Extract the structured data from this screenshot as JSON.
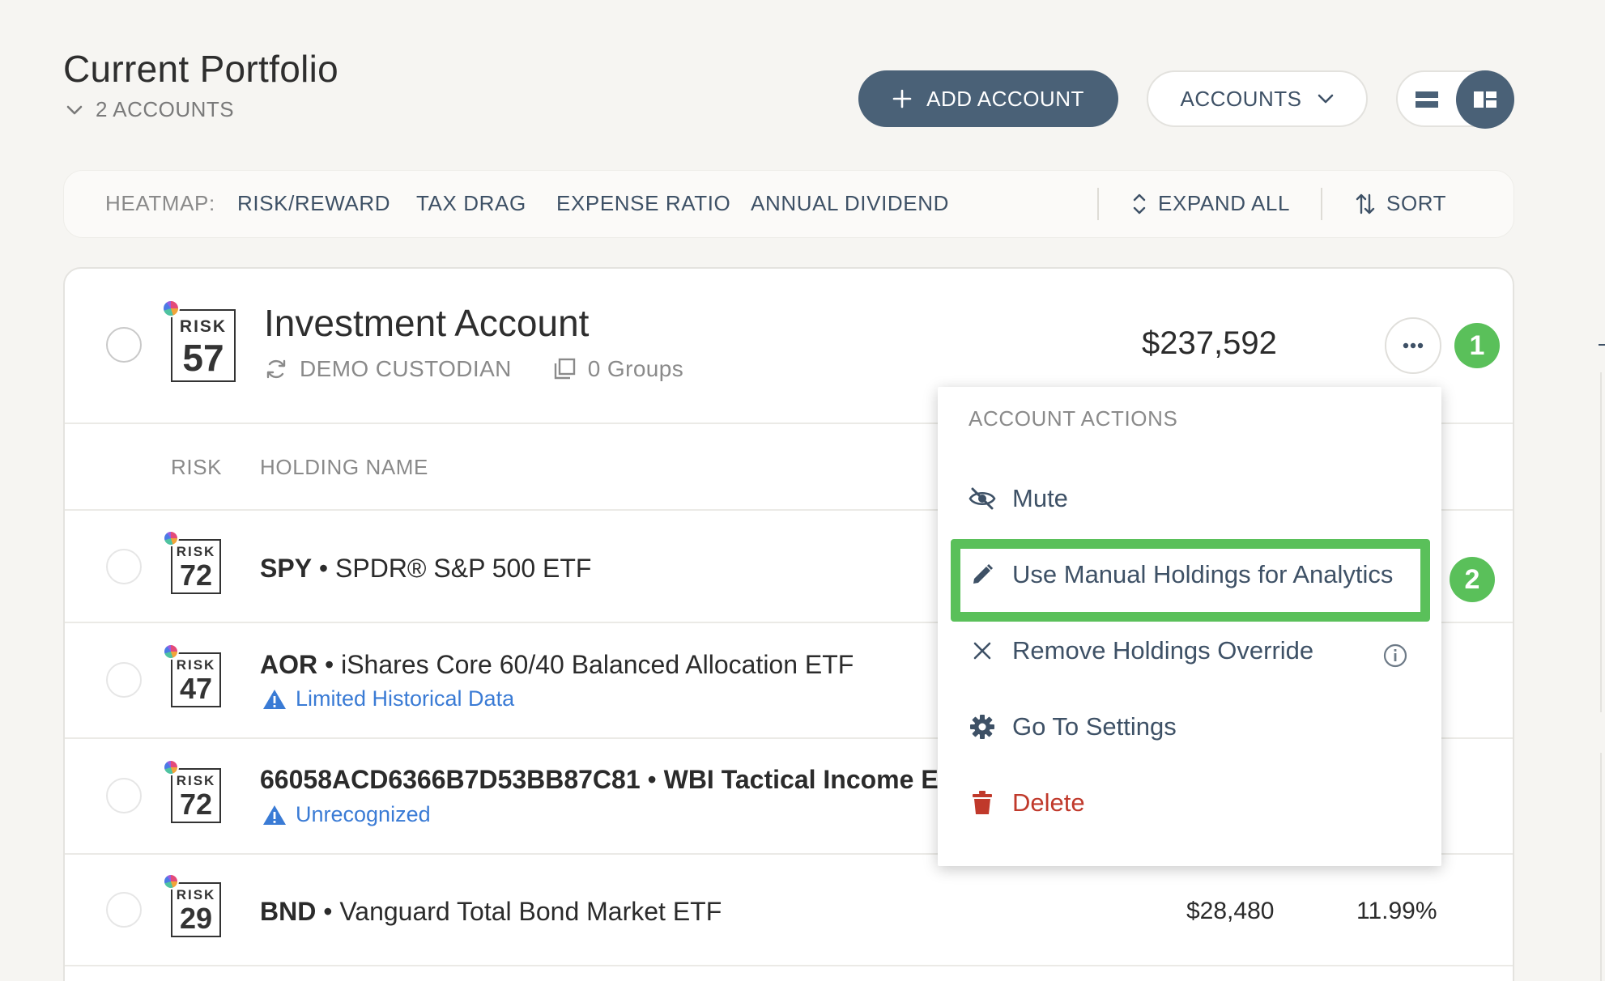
{
  "header": {
    "title": "Current Portfolio",
    "accounts_count": "2 ACCOUNTS",
    "add_account": "ADD ACCOUNT",
    "accounts_dropdown": "ACCOUNTS"
  },
  "heatmap": {
    "label": "HEATMAP:",
    "items": [
      "RISK/REWARD",
      "TAX DRAG",
      "EXPENSE RATIO",
      "ANNUAL DIVIDEND"
    ],
    "expand_all": "EXPAND ALL",
    "sort": "SORT"
  },
  "account": {
    "risk_label": "RISK",
    "risk_score": "57",
    "name": "Investment Account",
    "custodian": "DEMO CUSTODIAN",
    "groups": "0 Groups",
    "value": "$237,592",
    "step1": "1"
  },
  "columns": {
    "risk": "RISK",
    "holding_name": "HOLDING NAME"
  },
  "holdings": [
    {
      "risk": "72",
      "ticker": "SPY",
      "name": "SPDR® S&P 500 ETF",
      "warning": "",
      "value": "",
      "percent": ""
    },
    {
      "risk": "47",
      "ticker": "AOR",
      "name": "iShares Core 60/40 Balanced Allocation ETF",
      "warning": "Limited Historical Data",
      "value": "",
      "percent": ""
    },
    {
      "risk": "72",
      "ticker": "66058ACD6366B7D53BB87C81",
      "name": "WBI Tactical Income ETF",
      "warning": "Unrecognized",
      "value": "",
      "percent": ""
    },
    {
      "risk": "29",
      "ticker": "BND",
      "name": "Vanguard Total Bond Market ETF",
      "warning": "",
      "value": "$28,480",
      "percent": "11.99%"
    }
  ],
  "menu": {
    "heading": "ACCOUNT ACTIONS",
    "items": [
      {
        "label": "Mute",
        "icon": "eye-slash-icon"
      },
      {
        "label": "Use Manual Holdings for Analytics",
        "icon": "pencil-icon"
      },
      {
        "label": "Remove Holdings Override",
        "icon": "close-icon"
      },
      {
        "label": "Go To Settings",
        "icon": "gear-icon"
      },
      {
        "label": "Delete",
        "icon": "trash-icon"
      }
    ],
    "step2": "2"
  },
  "colors": {
    "primary": "#4a6177",
    "highlight_green": "#5ac05a",
    "link_blue": "#3a7bd5",
    "danger": "#c0392b"
  },
  "separator": "•"
}
